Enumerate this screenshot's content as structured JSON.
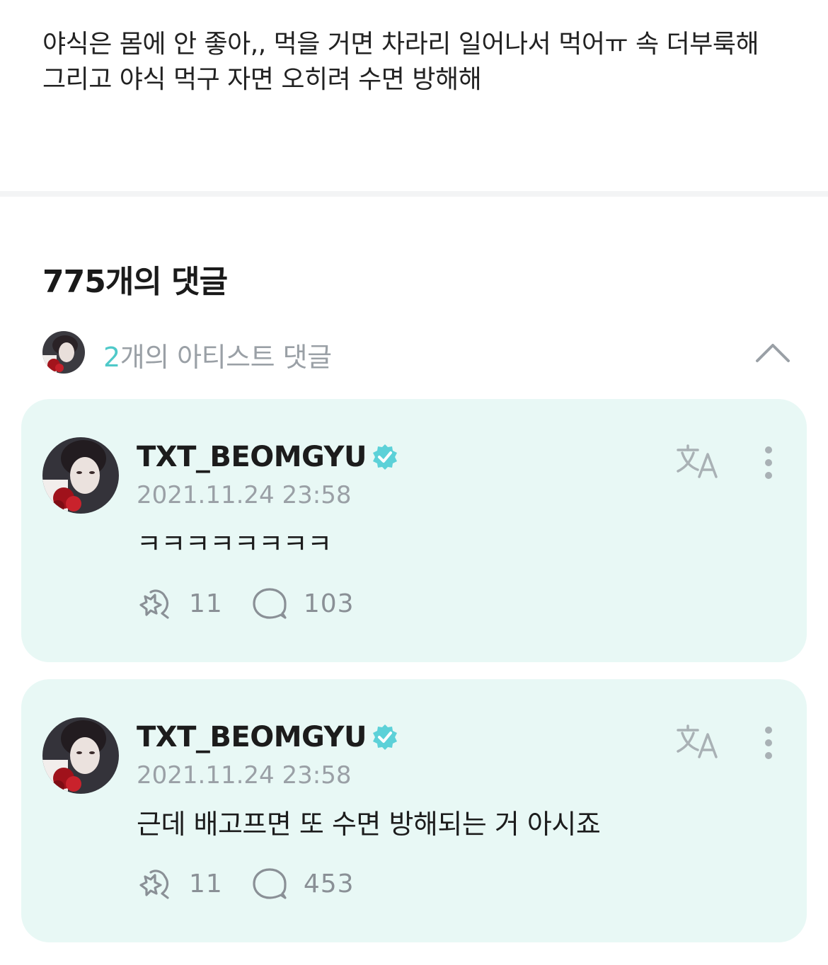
{
  "post": {
    "lines": [
      "야식은 몸에 안 좋아,, 먹을 거면 차라리 일어나서 먹어ㅠ 속 더부룩해",
      "그리고 야식 먹구 자면 오히려 수면 방해해"
    ]
  },
  "comments_header": {
    "title": "775개의 댓글"
  },
  "artist_section": {
    "count": "2",
    "label": "개의 아티스트 댓글",
    "collapse_icon": "chevron-up-icon"
  },
  "comments": [
    {
      "author": "TXT_BEOMGYU",
      "date": "2021.11.24 23:58",
      "text": "ㅋㅋㅋㅋㅋㅋㅋㅋ",
      "likes": "11",
      "replies": "103"
    },
    {
      "author": "TXT_BEOMGYU",
      "date": "2021.11.24 23:58",
      "text": "근데 배고프면 또 수면 방해되는 거 아시죠",
      "likes": "11",
      "replies": "453"
    }
  ],
  "colors": {
    "accent": "#4fc9c9",
    "card_bg": "#e8f8f5",
    "verified": "#5cd1d8",
    "muted": "#9aa0a6"
  },
  "icons": {
    "verified": "verified-badge-icon",
    "translate": "translate-icon",
    "more": "more-vertical-icon",
    "cheer": "cheer-heart-icon",
    "reply": "reply-bubble-icon"
  }
}
